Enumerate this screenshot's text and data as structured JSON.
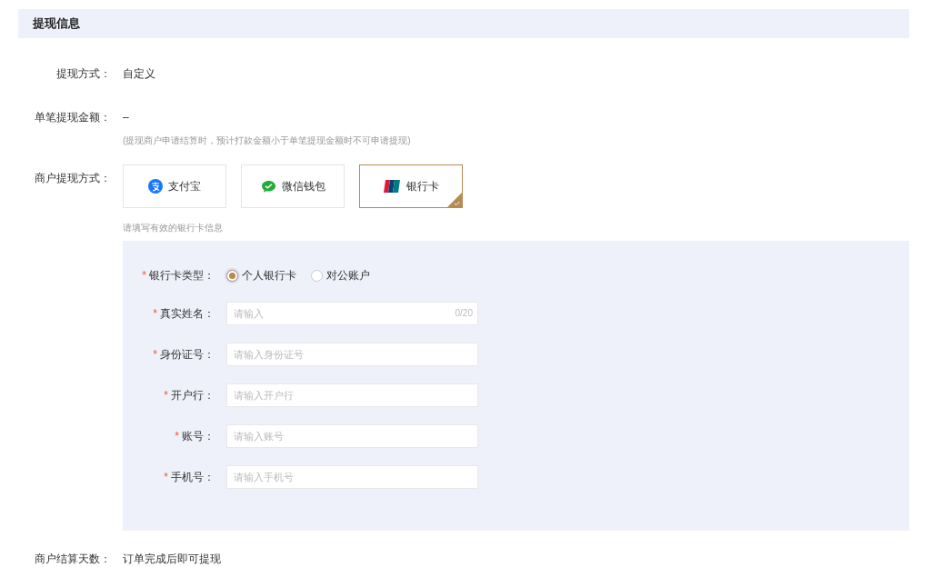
{
  "section": {
    "title": "提现信息"
  },
  "rows_top": [
    {
      "label": "提现方式：",
      "value": "自定义"
    },
    {
      "label": "单笔提现金额：",
      "value": "–",
      "hint": "(提现商户申请结算时，预计打款金额小于单笔提现金额时不可申请提现)"
    }
  ],
  "methods": {
    "label": "商户提现方式：",
    "hint": "请填写有效的银行卡信息",
    "options": [
      {
        "kind": "alipay",
        "label": "支付宝",
        "selected": false
      },
      {
        "kind": "wechat",
        "label": "微信钱包",
        "selected": false
      },
      {
        "kind": "unionpay",
        "label": "银行卡",
        "selected": true
      }
    ]
  },
  "bank_form": {
    "card_type": {
      "required_mark": "*",
      "label": "银行卡类型：",
      "options": [
        {
          "label": "个人银行卡",
          "selected": true
        },
        {
          "label": "对公账户",
          "selected": false
        }
      ]
    },
    "fields": [
      {
        "required_mark": "*",
        "label": "真实姓名：",
        "placeholder": "请输入",
        "counter": "0/20"
      },
      {
        "required_mark": "*",
        "label": "身份证号：",
        "placeholder": "请输入身份证号"
      },
      {
        "required_mark": "*",
        "label": "开户行：",
        "placeholder": "请输入开户行"
      },
      {
        "required_mark": "*",
        "label": "账号：",
        "placeholder": "请输入账号"
      },
      {
        "required_mark": "*",
        "label": "手机号：",
        "placeholder": "请输入手机号"
      }
    ]
  },
  "settlement": {
    "label": "商户结算天数：",
    "value": "订单完成后即可提现"
  }
}
